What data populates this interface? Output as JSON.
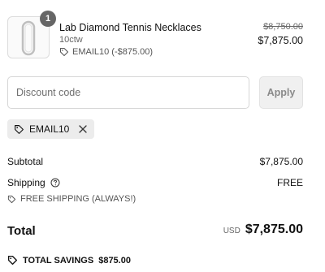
{
  "product": {
    "quantity": "1",
    "name": "Lab Diamond Tennis Necklaces",
    "variant": "10ctw",
    "discount_line": "EMAIL10 (-$875.00)",
    "original_price": "$8,750.00",
    "price": "$7,875.00",
    "icons": {
      "discount": "tag-icon"
    }
  },
  "discount": {
    "placeholder": "Discount code",
    "value": "",
    "apply_label": "Apply",
    "applied_code": "EMAIL10",
    "icons": {
      "code": "tag-icon",
      "remove": "close-icon"
    }
  },
  "summary": {
    "subtotal_label": "Subtotal",
    "subtotal_value": "$7,875.00",
    "shipping_label": "Shipping",
    "shipping_value": "FREE",
    "shipping_note": "FREE SHIPPING (ALWAYS!)",
    "total_label": "Total",
    "currency": "USD",
    "total_value": "$7,875.00",
    "savings_label": "TOTAL SAVINGS",
    "savings_value": "$875.00",
    "icons": {
      "shipping_help": "help-icon",
      "shipping_note": "tag-icon",
      "savings": "tag-icon"
    }
  },
  "colors": {
    "badge": "#666666",
    "chip_bg": "#ececec",
    "apply_bg": "#f0f0f0",
    "border": "#d6d6d6"
  }
}
